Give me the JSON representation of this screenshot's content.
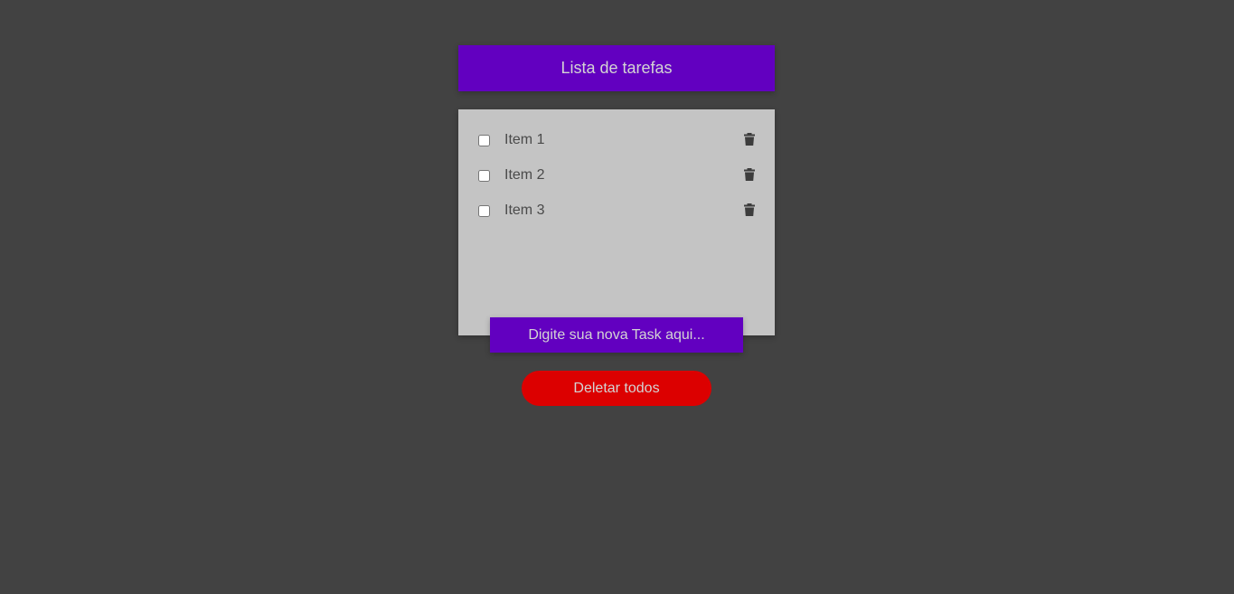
{
  "header": {
    "title": "Lista de tarefas"
  },
  "tasks": [
    {
      "label": "Item 1",
      "checked": false,
      "delete_icon": "trash-icon"
    },
    {
      "label": "Item 2",
      "checked": false,
      "delete_icon": "trash-icon"
    },
    {
      "label": "Item 3",
      "checked": false,
      "delete_icon": "trash-icon"
    }
  ],
  "new_task_input": {
    "placeholder": "Digite sua nova Task aqui...",
    "value": ""
  },
  "delete_all_button": {
    "label": "Deletar todos"
  },
  "colors": {
    "background": "#424242",
    "accent": "#6200c0",
    "card": "#c4c4c4",
    "danger": "#dc0000",
    "text_light": "#d4d4d4",
    "text_dark": "#4a4a4a"
  }
}
